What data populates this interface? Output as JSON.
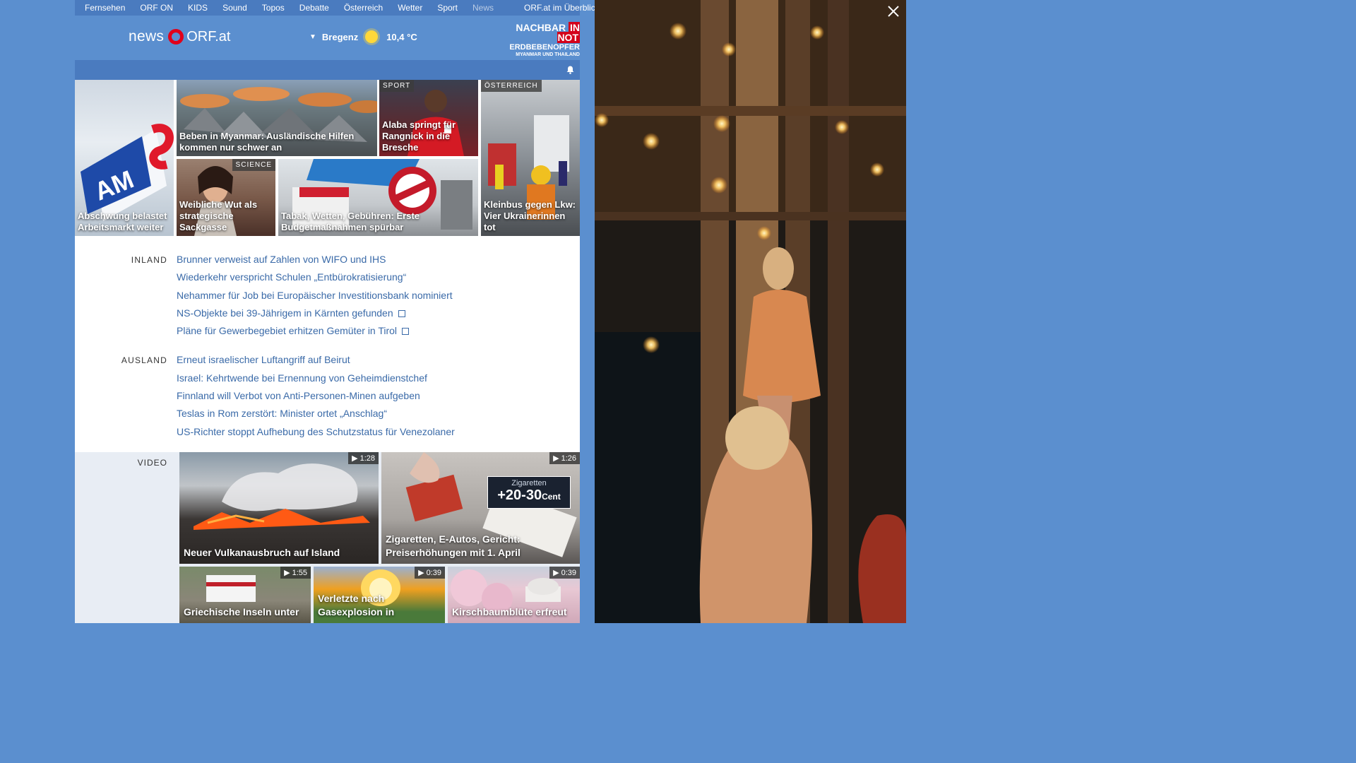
{
  "nav": {
    "items": [
      {
        "label": "Fernsehen"
      },
      {
        "label": "ORF ON"
      },
      {
        "label": "KIDS"
      },
      {
        "label": "Sound"
      },
      {
        "label": "Topos"
      },
      {
        "label": "Debatte"
      },
      {
        "label": "Österreich"
      },
      {
        "label": "Wetter"
      },
      {
        "label": "Sport"
      },
      {
        "label": "News"
      }
    ],
    "overview": "ORF.at im Überblick"
  },
  "logo": {
    "news": "news",
    "orf": "ORF.at"
  },
  "weather": {
    "city": "Bregenz",
    "temp": "10,4 °C"
  },
  "promo": {
    "line1a": "NACHBAR",
    "line1b": "IN NOT",
    "line2": "ERDBEBENOPFER",
    "line3": "MYANMAR UND THAILAND"
  },
  "tiles": [
    {
      "caption": "Abschwung belastet Arbeitsmarkt weiter",
      "badge": ""
    },
    {
      "caption": "Beben in Myanmar: Ausländische Hilfen kommen nur schwer an",
      "badge": ""
    },
    {
      "caption": "Alaba springt für Rangnick in die Bresche",
      "badge": "SPORT"
    },
    {
      "caption": "Kleinbus gegen Lkw: Vier Ukrainerinnen tot",
      "badge": "ÖSTERREICH"
    },
    {
      "caption": "Weibliche Wut als strategische Sackgasse",
      "badge": "SCIENCE"
    },
    {
      "caption": "Tabak, Wetten, Gebühren: Erste Budgetmaßnahmen spürbar",
      "badge": ""
    }
  ],
  "inland": {
    "label": "INLAND",
    "items": [
      "Brunner verweist auf Zahlen von WIFO und IHS",
      "Wiederkehr verspricht Schulen „Entbürokratisierung“",
      "Nehammer für Job bei Europäischer Investitionsbank nominiert",
      "NS-Objekte bei 39-Jährigem in Kärnten gefunden",
      "Pläne für Gewerbegebiet erhitzen Gemüter in Tirol"
    ]
  },
  "ausland": {
    "label": "AUSLAND",
    "items": [
      "Erneut israelischer Luftangriff auf Beirut",
      "Israel: Kehrtwende bei Ernennung von Geheimdienstchef",
      "Finnland will Verbot von Anti-Personen-Minen aufgeben",
      "Teslas in Rom zerstört: Minister ortet „Anschlag“",
      "US-Richter stoppt Aufhebung des Schutzstatus für Venezolaner"
    ]
  },
  "video": {
    "label": "VIDEO",
    "items": [
      {
        "caption": "Neuer Vulkanausbruch auf Island",
        "duration": "▶ 1:28"
      },
      {
        "caption": "Zigaretten, E-Autos, Gericht: Preiserhöhungen mit 1. April",
        "duration": "▶ 1:26",
        "overlay_top": "Zigaretten",
        "overlay_main": "+20-30",
        "overlay_unit": "Cent"
      },
      {
        "caption": "Griechische Inseln unter",
        "duration": "▶ 1:55"
      },
      {
        "caption": "Verletzte nach Gasexplosion in",
        "duration": "▶ 0:39"
      },
      {
        "caption": "Kirschbaumblüte erfreut",
        "duration": "▶ 0:39"
      }
    ]
  },
  "colors": {
    "brand_blue": "#5b8fcf",
    "nav_blue": "#4a7bbf",
    "link_blue": "#3a6aa8",
    "orf_red": "#e1001a"
  }
}
